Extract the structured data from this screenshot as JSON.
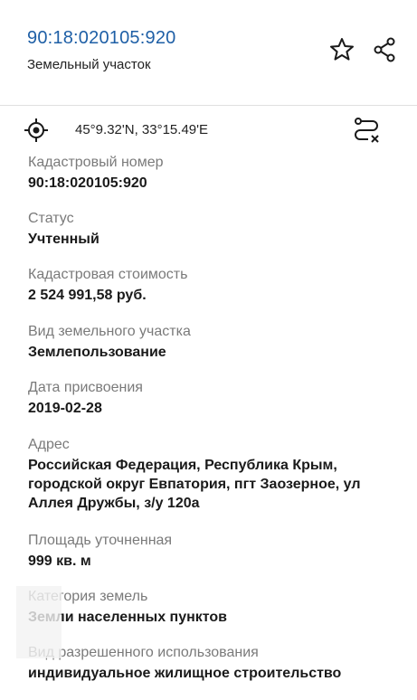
{
  "header": {
    "cadastral_link": "90:18:020105:920",
    "subtitle": "Земельный участок"
  },
  "coords": {
    "text": "45°9.32'N, 33°15.49'E"
  },
  "fields": [
    {
      "label": "Кадастровый номер",
      "value": "90:18:020105:920"
    },
    {
      "label": "Статус",
      "value": "Учтенный"
    },
    {
      "label": "Кадастровая стоимость",
      "value": "2 524 991,58 руб."
    },
    {
      "label": "Вид земельного участка",
      "value": "Землепользование"
    },
    {
      "label": "Дата присвоения",
      "value": "2019-02-28"
    },
    {
      "label": "Адрес",
      "value": "Российская Федерация, Республика Крым, городской округ Евпатория, пгт Заозерное, ул Аллея Дружбы, з/у 120а"
    },
    {
      "label": "Площадь уточненная",
      "value": "999 кв. м"
    },
    {
      "label": "Категория земель",
      "value": "Земли населенных пунктов"
    },
    {
      "label": "Вид разрешенного использования",
      "value": "индивидуальное жилищное строительство"
    }
  ]
}
